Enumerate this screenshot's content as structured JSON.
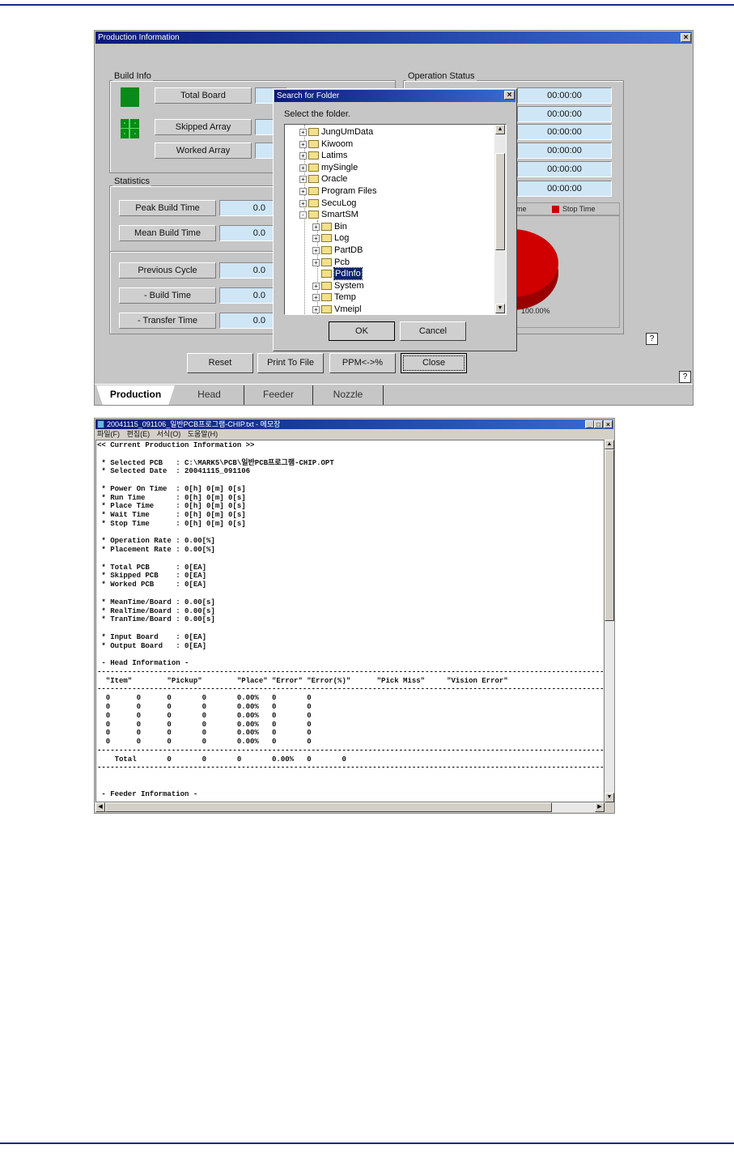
{
  "production_window": {
    "title": "Production Information",
    "build_info": {
      "label": "Build Info",
      "total_board": "Total Board",
      "skipped_array": "Skipped Array",
      "worked_array": "Worked Array"
    },
    "operation_status": {
      "label": "Operation Status",
      "times": [
        "00:00:00",
        "00:00:00",
        "00:00:00",
        "00:00:00",
        "00:00:00",
        "00:00:00"
      ],
      "legend_partial": "me",
      "legend_stop": "Stop Time",
      "pie_label": "100.00%",
      "stop_color": "#cc0000"
    },
    "statistics": {
      "label": "Statistics",
      "rows": [
        {
          "label": "Peak Build Time",
          "value": "0.0"
        },
        {
          "label": "Mean Build Time",
          "value": "0.0"
        },
        {
          "label": "Previous Cycle",
          "value": "0.0"
        },
        {
          "label": "- Build Time",
          "value": "0.0"
        },
        {
          "label": "- Transfer Time",
          "value": "0.0"
        }
      ]
    },
    "buttons": {
      "reset": "Reset",
      "print": "Print To File",
      "ppm": "PPM<->%",
      "close": "Close"
    },
    "help": "?",
    "tabs": [
      "Production",
      "Head",
      "Feeder",
      "Nozzle"
    ]
  },
  "folder_dialog": {
    "title": "Search for Folder",
    "prompt": "Select the folder.",
    "items": [
      {
        "name": "JungUmData",
        "level": 1,
        "exp": "+"
      },
      {
        "name": "Kiwoom",
        "level": 1,
        "exp": "+"
      },
      {
        "name": "Latims",
        "level": 1,
        "exp": "+"
      },
      {
        "name": "mySingle",
        "level": 1,
        "exp": "+"
      },
      {
        "name": "Oracle",
        "level": 1,
        "exp": "+"
      },
      {
        "name": "Program Files",
        "level": 1,
        "exp": "+"
      },
      {
        "name": "SecuLog",
        "level": 1,
        "exp": "+"
      },
      {
        "name": "SmartSM",
        "level": 1,
        "exp": "-"
      },
      {
        "name": "Bin",
        "level": 2,
        "exp": "+"
      },
      {
        "name": "Log",
        "level": 2,
        "exp": "+"
      },
      {
        "name": "PartDB",
        "level": 2,
        "exp": "+"
      },
      {
        "name": "Pcb",
        "level": 2,
        "exp": "+"
      },
      {
        "name": "PdInfo",
        "level": 2,
        "exp": "",
        "selected": true
      },
      {
        "name": "System",
        "level": 2,
        "exp": "+"
      },
      {
        "name": "Temp",
        "level": 2,
        "exp": "+"
      },
      {
        "name": "Vmeipl",
        "level": 2,
        "exp": "+"
      }
    ],
    "ok": "OK",
    "cancel": "Cancel"
  },
  "notepad": {
    "title": "20041115_091106_일반PCB프로그램-CHIP.txt - 메모장",
    "menu": [
      "파일(F)",
      "편집(E)",
      "서식(O)",
      "도움말(H)"
    ],
    "lines": [
      "<< Current Production Information >>",
      "",
      " * Selected PCB   : C:\\MARK5\\PCB\\일반PCB프로그램-CHIP.OPT",
      " * Selected Date  : 20041115_091106",
      "",
      " * Power On Time  : 0[h] 0[m] 0[s]",
      " * Run Time       : 0[h] 0[m] 0[s]",
      " * Place Time     : 0[h] 0[m] 0[s]",
      " * Wait Time      : 0[h] 0[m] 0[s]",
      " * Stop Time      : 0[h] 0[m] 0[s]",
      "",
      " * Operation Rate : 0.00[%]",
      " * Placement Rate : 0.00[%]",
      "",
      " * Total PCB      : 0[EA]",
      " * Skipped PCB    : 0[EA]",
      " * Worked PCB     : 0[EA]",
      "",
      " * MeanTime/Board : 0.00[s]",
      " * RealTime/Board : 0.00[s]",
      " * TranTime/Board : 0.00[s]",
      "",
      " * Input Board    : 0[EA]",
      " * Output Board   : 0[EA]",
      "",
      " - Head Information -",
      "------------------------------------------------------------------------------------------------------------------------",
      "  \"Item\"        \"Pickup\"        \"Place\" \"Error\" \"Error(%)\"      \"Pick Miss\"     \"Vision Error\"",
      "------------------------------------------------------------------------------------------------------------------------",
      "  0      0      0       0       0.00%   0       0",
      "  0      0      0       0       0.00%   0       0",
      "  0      0      0       0       0.00%   0       0",
      "  0      0      0       0       0.00%   0       0",
      "  0      0      0       0       0.00%   0       0",
      "  0      0      0       0       0.00%   0       0",
      "------------------------------------------------------------------------------------------------------------------------",
      "    Total       0       0       0       0.00%   0       0",
      "------------------------------------------------------------------------------------------------------------------------",
      "",
      "",
      " - Feeder Information -"
    ]
  }
}
